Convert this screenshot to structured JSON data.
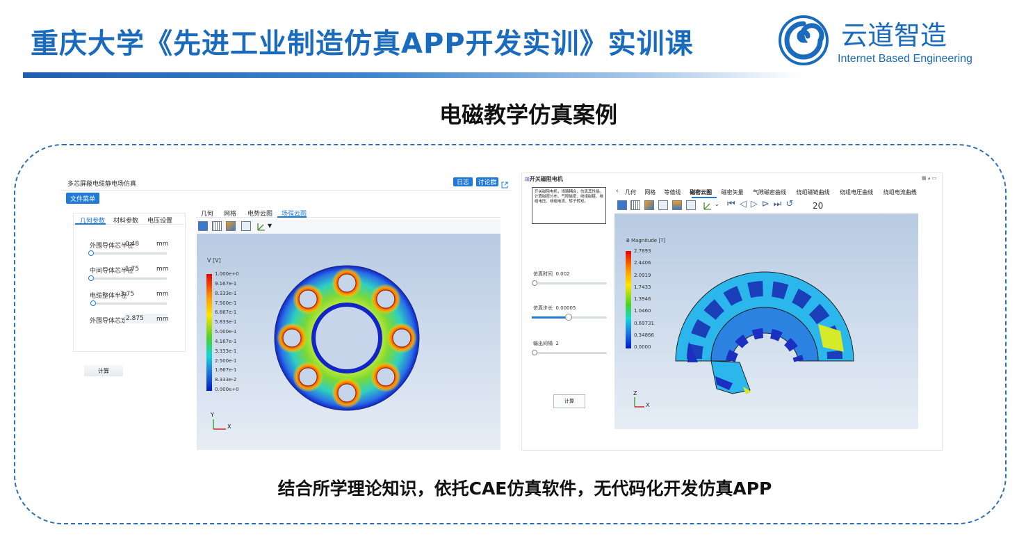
{
  "header": {
    "title": "重庆大学《先进工业制造仿真APP开发实训》实训课",
    "logo_cn": "云道智造",
    "logo_en": "Internet Based Engineering"
  },
  "subtitle": "电磁教学仿真案例",
  "caption": "结合所学理论知识，依托CAE仿真软件，无代码化开发仿真APP",
  "colors": {
    "brand": "#1a6bbd",
    "accent_button": "#1f7ad8",
    "frame_border": "#2d6fb5"
  },
  "app1": {
    "title": "多芯屏蔽电缆静电场仿真",
    "log_btn": "日志",
    "forum_btn": "讨论群",
    "file_menu": "文件菜单",
    "param_tabs": [
      "几何参数",
      "材料参数",
      "电压设置"
    ],
    "params": [
      {
        "label": "外围导体芯半径",
        "value": "0.48",
        "unit": "mm",
        "fraction": 0.0
      },
      {
        "label": "中间导体芯半径",
        "value": "1.75",
        "unit": "mm",
        "fraction": 0.0
      },
      {
        "label": "电缆整体半径",
        "value": "3.75",
        "unit": "mm",
        "fraction": 0.03
      },
      {
        "label": "外围导体芯定位",
        "value": "2.875",
        "unit": "mm"
      }
    ],
    "compute_btn": "计算",
    "view_tabs": [
      "几何",
      "网格",
      "电势云图",
      "场强云图"
    ],
    "legend_title": "V [V]",
    "legend_values": [
      "1.000e+0",
      "9.167e-1",
      "8.333e-1",
      "7.500e-1",
      "6.667e-1",
      "5.833e-1",
      "5.000e-1",
      "4.167e-1",
      "3.333e-1",
      "2.500e-1",
      "1.667e-1",
      "8.333e-2",
      "0.000e+0"
    ],
    "axis_y": "Y",
    "axis_x": "X"
  },
  "app2": {
    "title": "开关磁阻电机",
    "description": "开关磁阻电机，场路耦合，仿真其性能。计算磁密分布、气隙磁密、绕组磁链、绕组电压、绕组电流、转子转矩。",
    "view_tabs": [
      "几何",
      "网格",
      "等值线",
      "磁密云图",
      "磁密矢量",
      "气隙磁密曲线",
      "绕组磁链曲线",
      "绕组电压曲线",
      "绕组电流曲线"
    ],
    "frame_number": "20",
    "params": [
      {
        "label": "仿真时间",
        "value": "0.002",
        "fraction": 0.0
      },
      {
        "label": "仿真步长",
        "value": "0.00005",
        "fraction": 0.5
      },
      {
        "label": "输出间隔",
        "value": "2",
        "fraction": 0.0
      }
    ],
    "compute_btn": "计算",
    "legend_title": "B Magnitude [T]",
    "legend_values": [
      "2.7893",
      "2.4406",
      "2.0919",
      "1.7433",
      "1.3946",
      "1.0460",
      "0.69731",
      "0.34866",
      "0.0000"
    ],
    "axis_z": "Z",
    "axis_x": "X"
  }
}
